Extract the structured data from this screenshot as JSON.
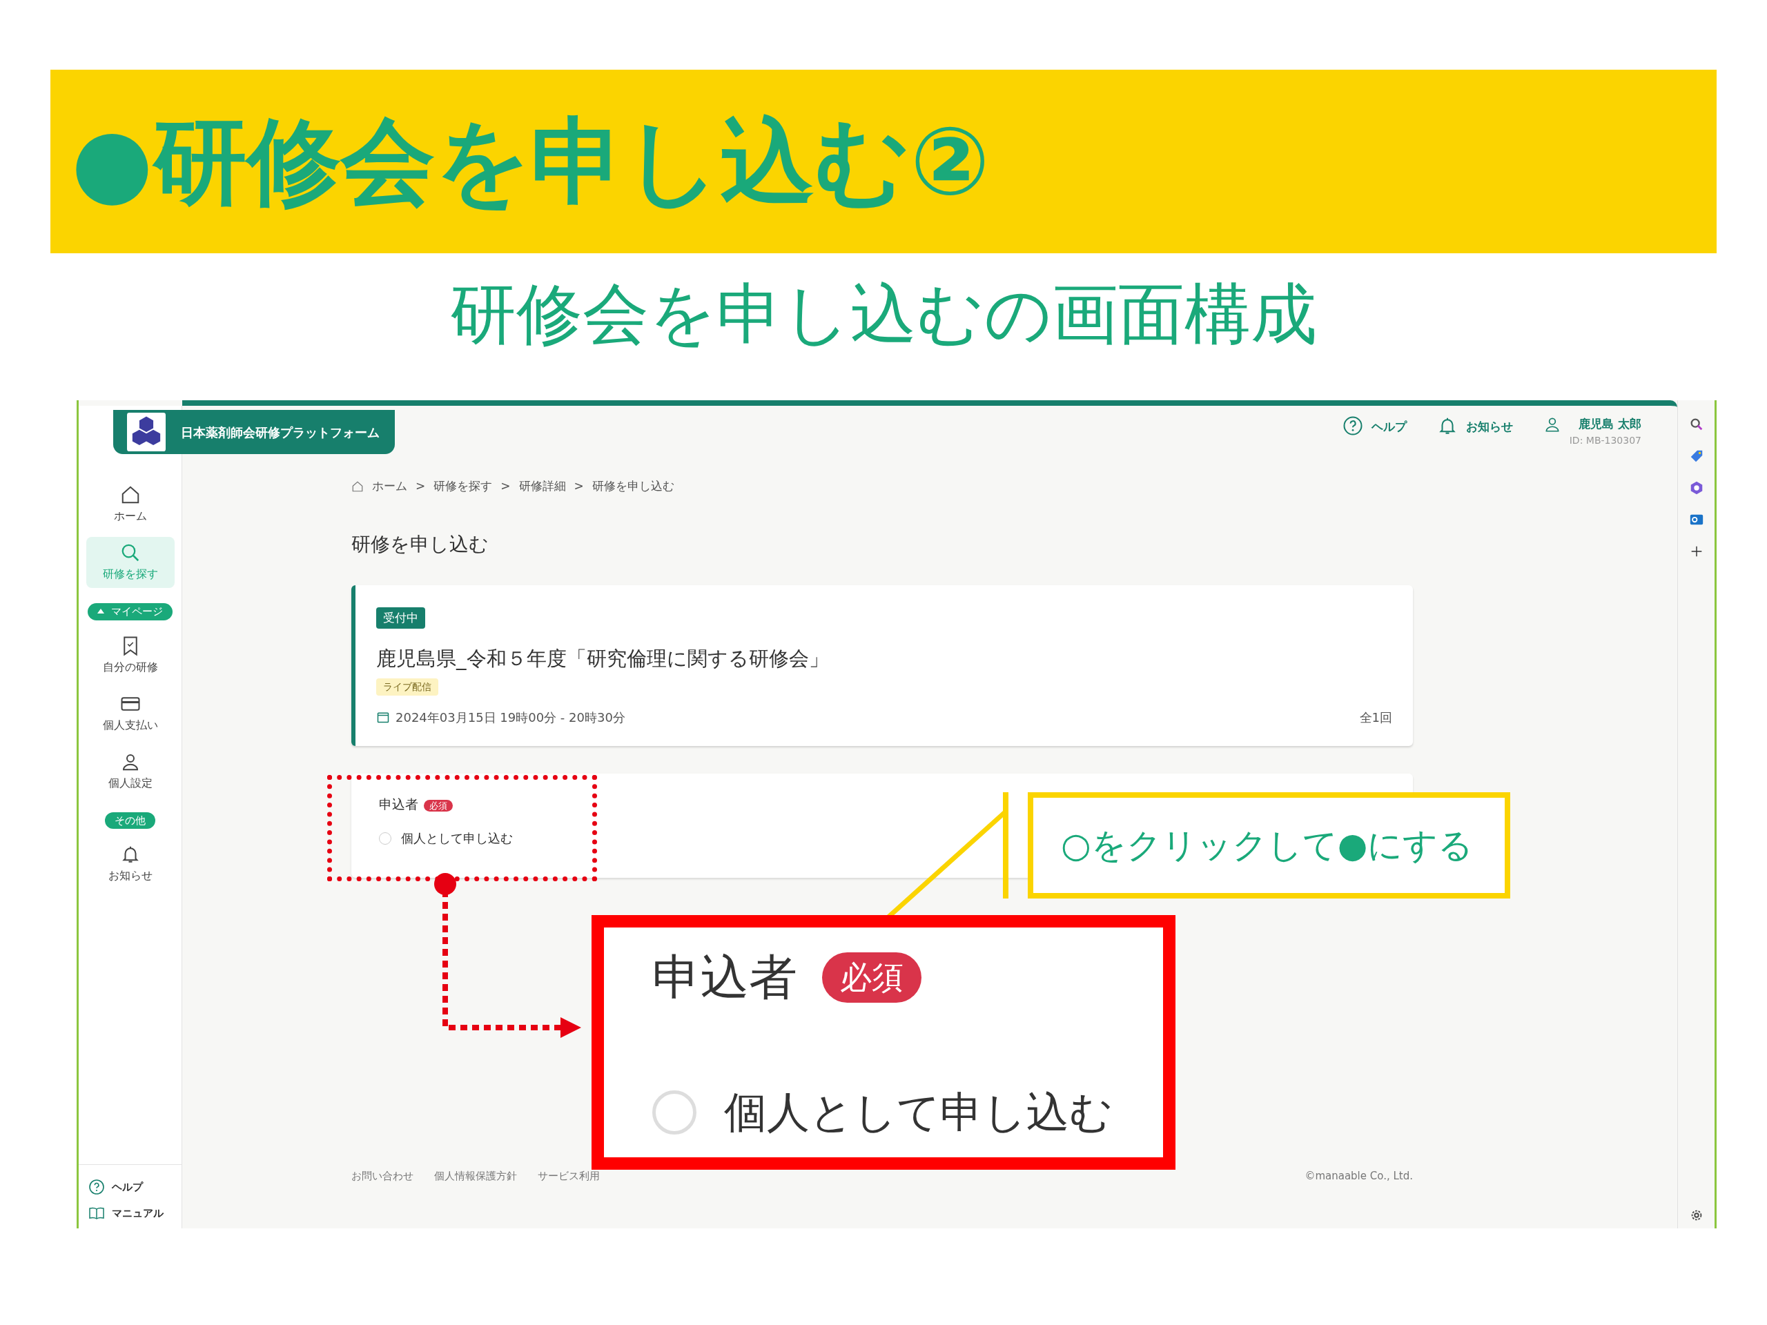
{
  "slide": {
    "title": "●研修会を申し込む②",
    "subtitle": "研修会を申し込むの画面構成"
  },
  "app": {
    "brand": "日本薬剤師会研修プラットフォーム",
    "header_links": [
      {
        "label": "ヘルプ"
      },
      {
        "label": "お知らせ"
      }
    ],
    "user": {
      "name": "鹿児島 太郎",
      "id": "ID: MB-130307"
    }
  },
  "sidebar": {
    "items": [
      {
        "kind": "nav",
        "label": "ホーム",
        "selected": false
      },
      {
        "kind": "nav",
        "label": "研修を探す",
        "selected": true
      },
      {
        "kind": "section",
        "label": "マイページ",
        "expanded": true
      },
      {
        "kind": "nav",
        "label": "自分の研修",
        "selected": false
      },
      {
        "kind": "nav",
        "label": "個人支払い",
        "selected": false
      },
      {
        "kind": "nav",
        "label": "個人設定",
        "selected": false
      },
      {
        "kind": "section",
        "label": "その他",
        "expanded": false
      },
      {
        "kind": "nav",
        "label": "お知らせ",
        "selected": false
      }
    ],
    "footer": [
      {
        "label": "ヘルプ"
      },
      {
        "label": "マニュアル"
      }
    ]
  },
  "breadcrumb": {
    "separator": ">",
    "items": [
      "ホーム",
      "研修を探す",
      "研修詳細",
      "研修を申し込む"
    ]
  },
  "page_title": "研修を申し込む",
  "course": {
    "status": "受付中",
    "title": "鹿児島県_令和５年度「研究倫理に関する研修会」",
    "tag": "ライブ配信",
    "datetime": "2024年03月15日 19時00分 - 20時30分",
    "sessions": "全1回"
  },
  "form": {
    "label": "申込者",
    "required": "必須",
    "options": [
      {
        "label": "個人として申し込む",
        "selected": false
      }
    ]
  },
  "footer": {
    "links": [
      "お問い合わせ",
      "個人情報保護方針",
      "サービス利用"
    ],
    "copyright": "©manaable Co., Ltd."
  },
  "annotation": {
    "callout": "○をクリックして●にする",
    "zoom": {
      "label": "申込者",
      "required": "必須",
      "option": {
        "label": "個人として申し込む",
        "selected": false
      }
    }
  }
}
